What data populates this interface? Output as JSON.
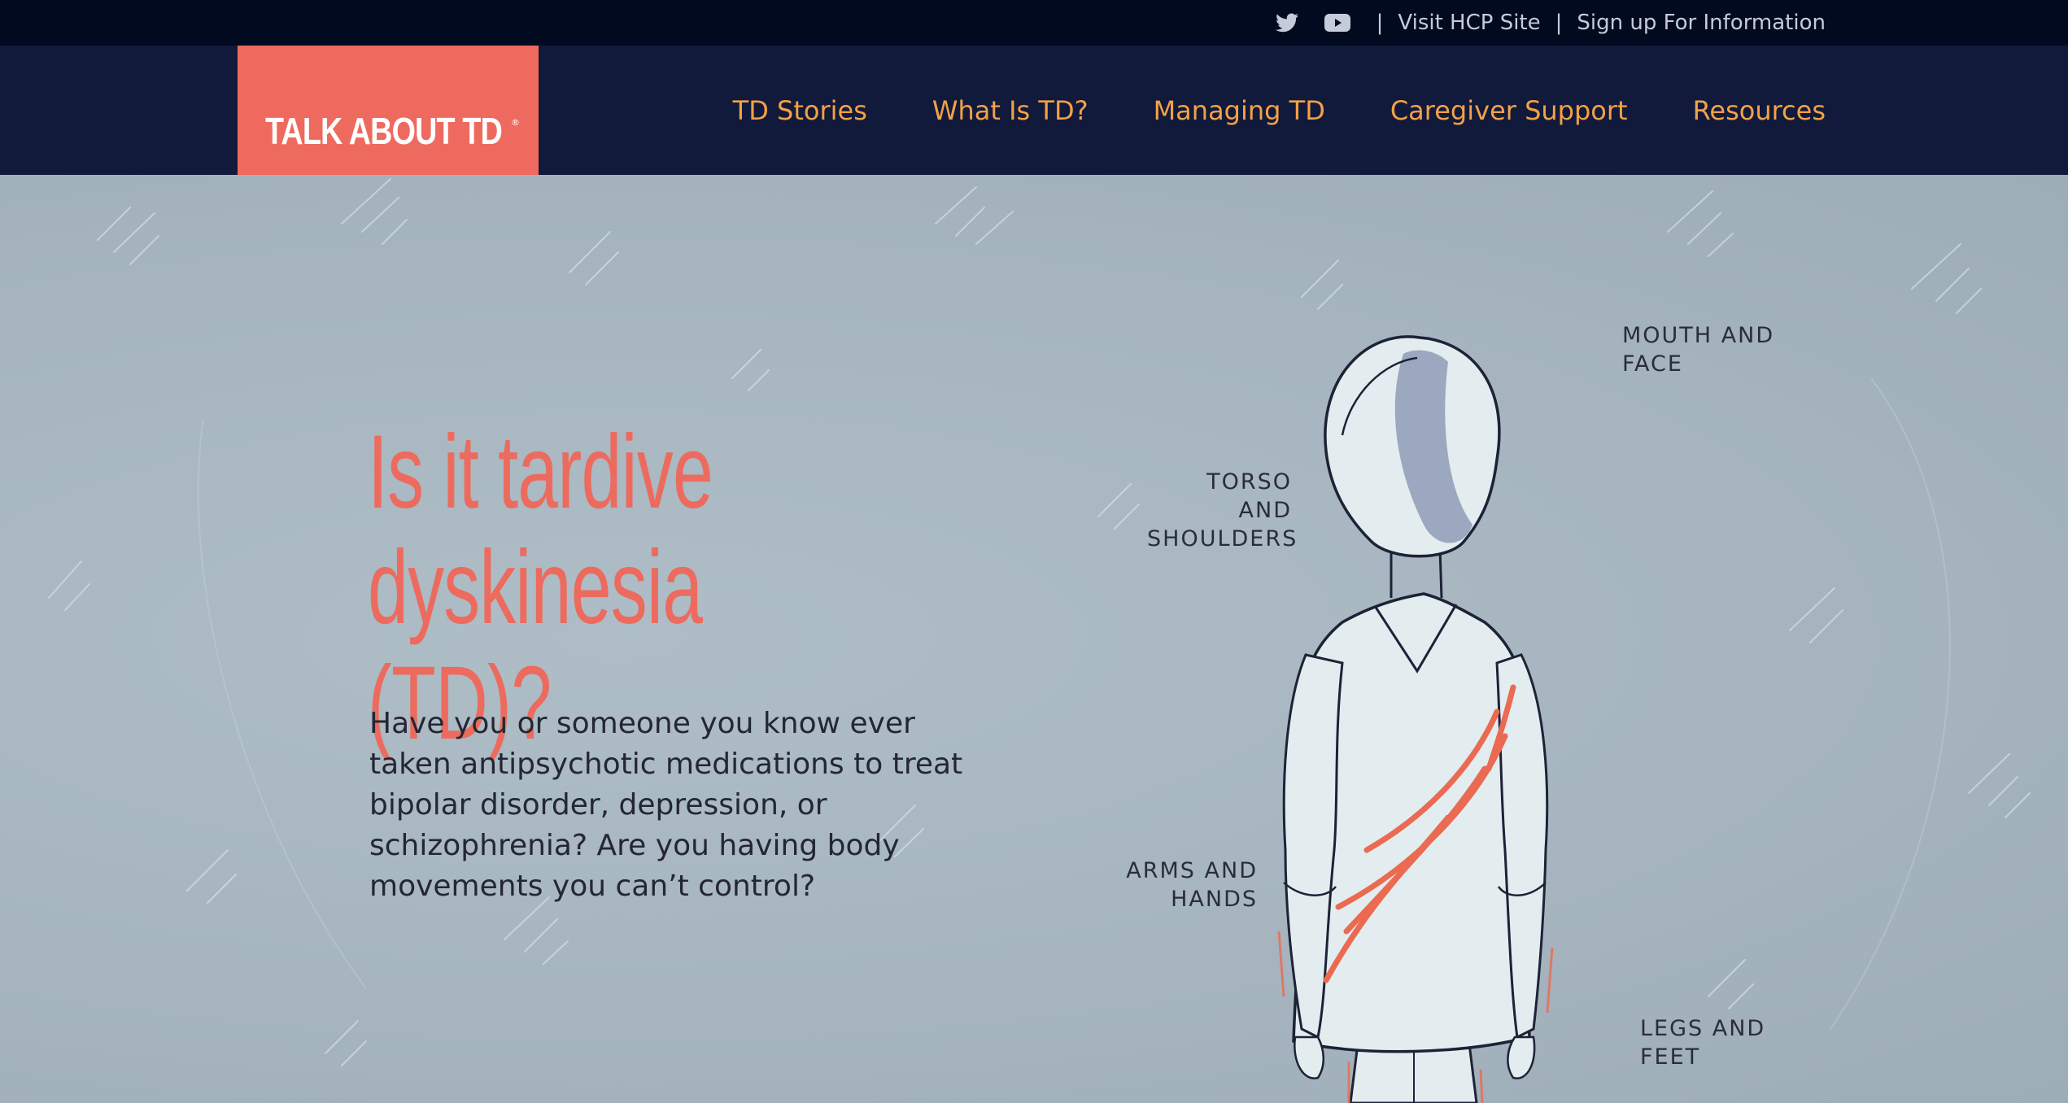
{
  "utility_bar": {
    "icons": [
      "twitter-icon",
      "youtube-icon"
    ],
    "separator": "|",
    "links": [
      "Visit HCP Site",
      "Sign up For Information"
    ]
  },
  "header": {
    "logo_text": "TALK ABOUT TD",
    "logo_mark": "®",
    "nav": [
      "TD Stories",
      "What Is TD?",
      "Managing TD",
      "Caregiver Support",
      "Resources"
    ]
  },
  "hero": {
    "title_line1": "Is it tardive",
    "title_line2": "dyskinesia (TD)?",
    "body": "Have you or someone you know ever taken antipsychotic medications to treat bipolar disorder, depression, or schizophrenia? Are you having body movements you can’t control?",
    "labels": {
      "mouth_face_1": "MOUTH AND",
      "mouth_face_2": "FACE",
      "torso_1": "TORSO AND",
      "torso_2": "SHOULDERS",
      "arms_1": "ARMS AND",
      "arms_2": "HANDS",
      "legs_1": "LEGS AND",
      "legs_2": "FEET"
    }
  },
  "colors": {
    "utility_bg": "#020a1f",
    "nav_bg": "#111a3a",
    "logo_bg": "#ef6a5e",
    "nav_link": "#f4a147",
    "hero_bg": "#a6b5bf",
    "title": "#ec6b5e",
    "body_text": "#242733"
  }
}
